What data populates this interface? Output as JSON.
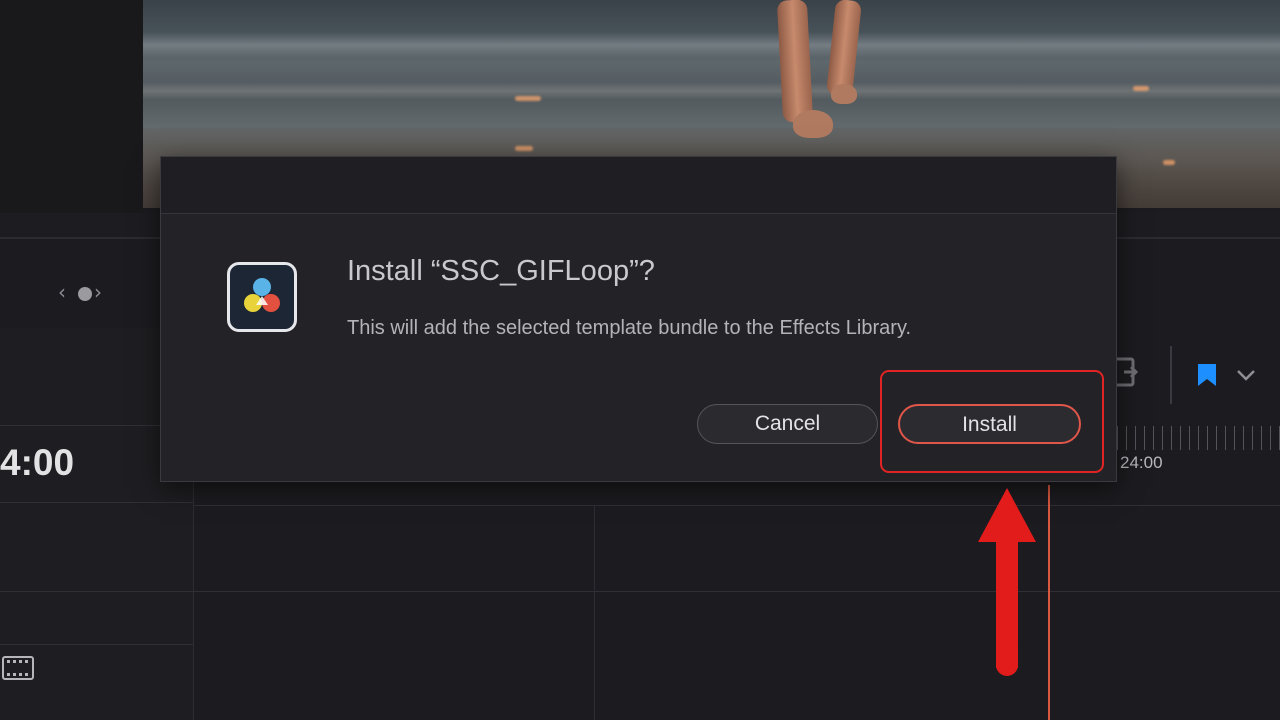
{
  "dialog": {
    "title": "Install “SSC_GIFLoop”?",
    "message": "This will add the selected template bundle to the Effects Library.",
    "cancel_label": "Cancel",
    "install_label": "Install"
  },
  "timeline": {
    "timecode_left": "4:00",
    "ruler_timecode": "24:00"
  },
  "colors": {
    "install_border": "#e0564a",
    "annotation_red": "#e02424",
    "playhead": "#d9583f",
    "marker_blue": "#1e8fff"
  },
  "icons": [
    "chevron-left-icon",
    "dot-icon",
    "chevron-right-icon",
    "davinci-resolve-logo-icon",
    "film-strip-icon",
    "marker-flag-icon",
    "chevron-down-icon",
    "export-icon",
    "annotation-arrow-icon"
  ]
}
